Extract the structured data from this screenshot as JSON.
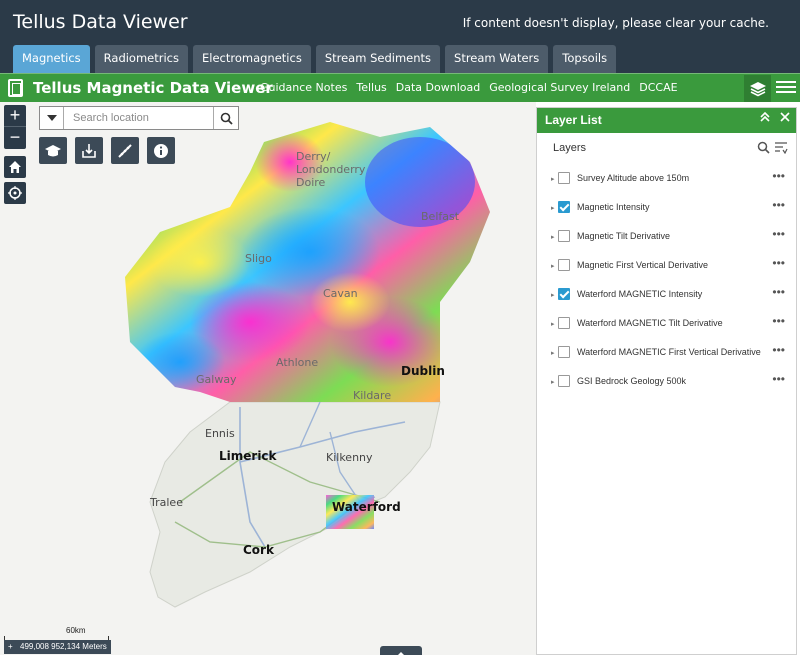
{
  "header": {
    "title": "Tellus Data Viewer",
    "cache_note": "If content doesn't display, please clear your cache."
  },
  "tabs": [
    {
      "label": "Magnetics",
      "active": true
    },
    {
      "label": "Radiometrics",
      "active": false
    },
    {
      "label": "Electromagnetics",
      "active": false
    },
    {
      "label": "Stream Sediments",
      "active": false
    },
    {
      "label": "Stream Waters",
      "active": false
    },
    {
      "label": "Topsoils",
      "active": false
    }
  ],
  "viewer": {
    "title": "Tellus Magnetic Data Viewer",
    "links": [
      "Guidance Notes",
      "Tellus",
      "Data Download",
      "Geological Survey Ireland",
      "DCCAE"
    ],
    "accent_color": "#3a9a3d"
  },
  "map": {
    "search_placeholder": "Search location",
    "zoom_in": "+",
    "zoom_out": "−",
    "places": {
      "derry": "Derry/\nLondonderry\nDoire",
      "belfast": "Belfast",
      "sligo": "Sligo",
      "cavan": "Cavan",
      "athlone": "Athlone",
      "galway": "Galway",
      "dublin": "Dublin",
      "kildare": "Kildare",
      "ennis": "Ennis",
      "limerick": "Limerick",
      "kilkenny": "Kilkenny",
      "tralee": "Tralee",
      "waterford": "Waterford",
      "cork": "Cork"
    },
    "scale_label": "60km",
    "coordinates": "499,008 952,134 Meters"
  },
  "layer_panel": {
    "title": "Layer List",
    "subtitle": "Layers",
    "layers": [
      {
        "name": "Survey Altitude above 150m",
        "checked": false
      },
      {
        "name": "Magnetic Intensity",
        "checked": true
      },
      {
        "name": "Magnetic Tilt Derivative",
        "checked": false
      },
      {
        "name": "Magnetic First Vertical Derivative",
        "checked": false
      },
      {
        "name": "Waterford MAGNETIC Intensity",
        "checked": true
      },
      {
        "name": "Waterford MAGNETIC Tilt Derivative",
        "checked": false
      },
      {
        "name": "Waterford MAGNETIC First Vertical Derivative",
        "checked": false
      },
      {
        "name": "GSI Bedrock Geology 500k",
        "checked": false
      }
    ]
  }
}
